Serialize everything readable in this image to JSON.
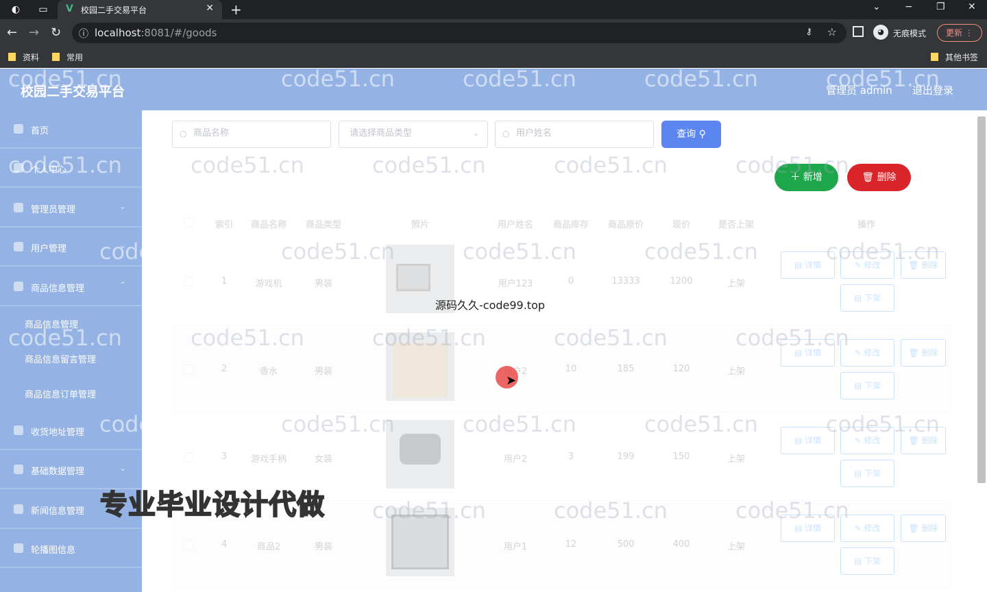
{
  "browser": {
    "tab_title": "校园二手交易平台",
    "url_host": "localhost",
    "url_rest": ":8081/#/goods",
    "incognito_label": "无痕模式",
    "update_label": "更新",
    "bookmarks": [
      "资料",
      "常用"
    ],
    "other_bookmarks": "其他书签"
  },
  "header": {
    "title": "校园二手交易平台",
    "admin": "管理员 admin",
    "logout": "退出登录"
  },
  "sidebar": {
    "items": [
      {
        "label": "首页"
      },
      {
        "label": "个人中心"
      },
      {
        "label": "管理员管理"
      },
      {
        "label": "用户管理"
      },
      {
        "label": "商品信息管理"
      },
      {
        "label": "收货地址管理"
      },
      {
        "label": "基础数据管理"
      },
      {
        "label": "新闻信息管理"
      },
      {
        "label": "轮播图信息"
      }
    ],
    "submenu": [
      "商品信息管理",
      "商品信息留言管理",
      "商品信息订单管理"
    ]
  },
  "search": {
    "name_placeholder": "商品名称",
    "type_placeholder": "请选择商品类型",
    "user_placeholder": "用户姓名",
    "query_label": "查询"
  },
  "actions": {
    "add_label": "新增",
    "delete_label": "删除"
  },
  "table": {
    "headers": [
      "索引",
      "商品名称",
      "商品类型",
      "照片",
      "用户姓名",
      "商品库存",
      "商品原价",
      "现价",
      "是否上架",
      "操作"
    ],
    "rows": [
      {
        "index": "1",
        "name": "游戏机",
        "type": "男装",
        "user": "用户123",
        "stock": "0",
        "original": "13333",
        "price": "1200",
        "shelf": "上架"
      },
      {
        "index": "2",
        "name": "香水",
        "type": "男装",
        "user": "用户2",
        "stock": "10",
        "original": "185",
        "price": "120",
        "shelf": "上架"
      },
      {
        "index": "3",
        "name": "游戏手柄",
        "type": "女装",
        "user": "用户2",
        "stock": "3",
        "original": "199",
        "price": "150",
        "shelf": "上架"
      },
      {
        "index": "4",
        "name": "商品2",
        "type": "男装",
        "user": "用户1",
        "stock": "12",
        "original": "500",
        "price": "400",
        "shelf": "上架"
      }
    ],
    "op_labels": {
      "detail": "详情",
      "edit": "修改",
      "delete": "删除",
      "off": "下架"
    }
  },
  "overlays": {
    "watermark": "code51.cn",
    "caption": "源码久久-code99.top",
    "ad": "专业毕业设计代做"
  },
  "colors": {
    "header_bg": "#94b3e4",
    "query_btn": "#5b86f0",
    "add_btn": "#1ea64a",
    "delete_btn": "#d9242a"
  }
}
